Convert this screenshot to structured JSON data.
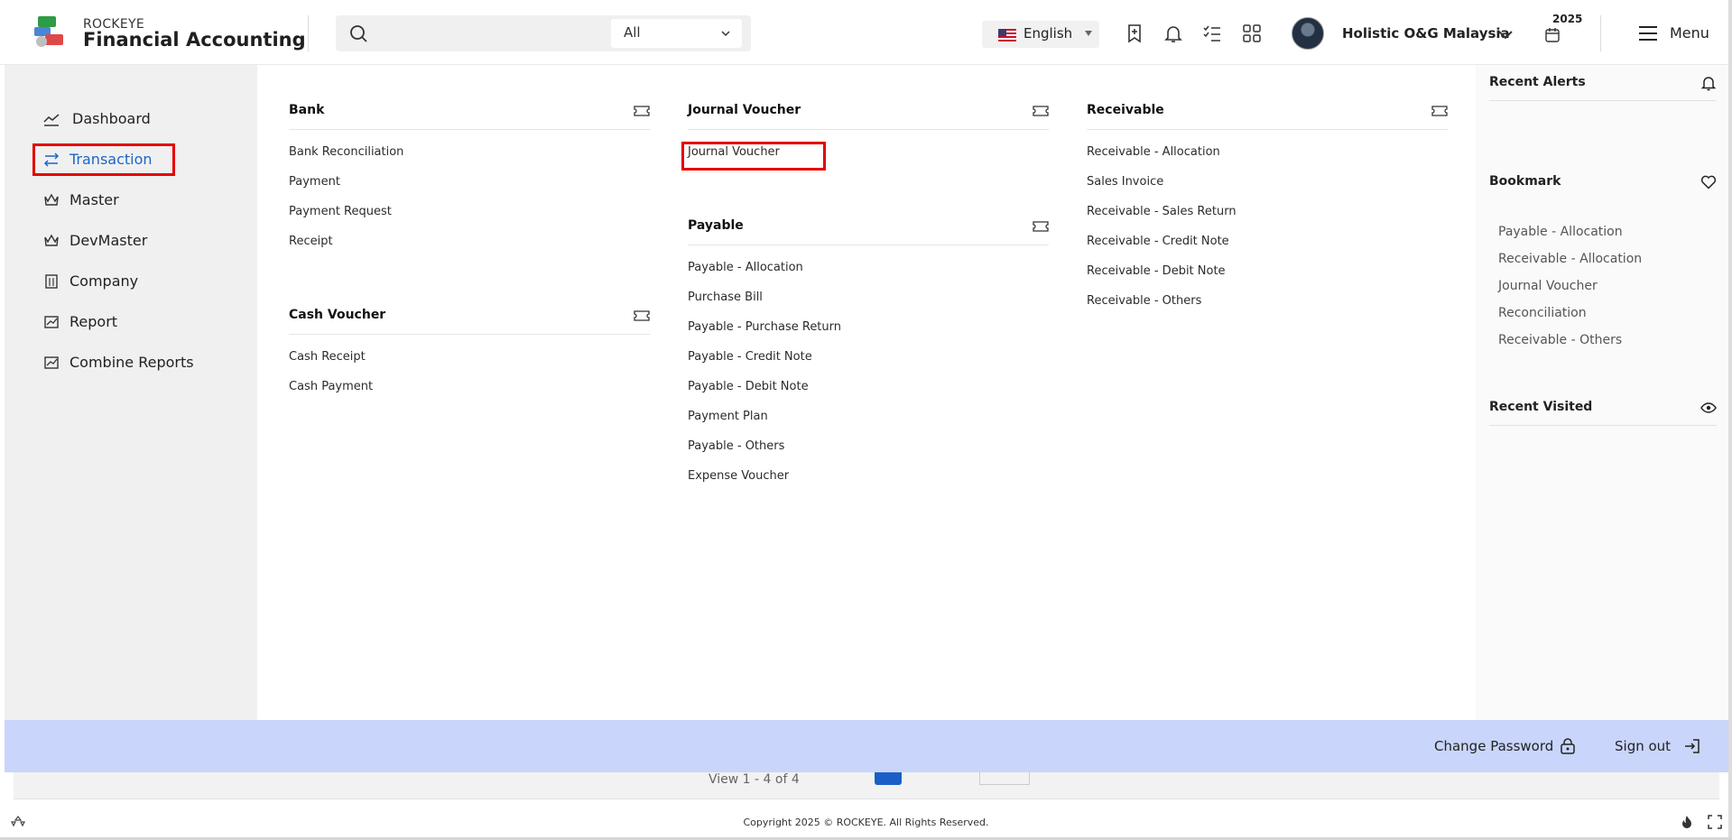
{
  "header": {
    "brand_top": "ROCKEYE",
    "brand_main": "Financial Accounting",
    "search": {
      "placeholder": "",
      "filter_value": "All"
    },
    "language": "English",
    "user_name": "Holistic O&G Malaysia",
    "year": "2025",
    "menu_label": "Menu"
  },
  "sidebar": {
    "items": [
      {
        "label": "Dashboard",
        "icon": "trend-icon",
        "active": false
      },
      {
        "label": "Transaction",
        "icon": "swap-icon",
        "active": true
      },
      {
        "label": "Master",
        "icon": "crown-icon",
        "active": false
      },
      {
        "label": "DevMaster",
        "icon": "crown-icon",
        "active": false
      },
      {
        "label": "Company",
        "icon": "building-icon",
        "active": false
      },
      {
        "label": "Report",
        "icon": "chart-icon",
        "active": false
      },
      {
        "label": "Combine Reports",
        "icon": "chart-icon",
        "active": false
      }
    ]
  },
  "sections": {
    "bank": {
      "title": "Bank",
      "links": [
        "Bank Reconciliation",
        "Payment",
        "Payment Request",
        "Receipt"
      ]
    },
    "cash_voucher": {
      "title": "Cash Voucher",
      "links": [
        "Cash Receipt",
        "Cash Payment"
      ]
    },
    "journal_voucher": {
      "title": "Journal Voucher",
      "links": [
        "Journal Voucher"
      ]
    },
    "payable": {
      "title": "Payable",
      "links": [
        "Payable - Allocation",
        "Purchase Bill",
        "Payable - Purchase Return",
        "Payable - Credit Note",
        "Payable - Debit Note",
        "Payment Plan",
        "Payable - Others",
        "Expense Voucher"
      ]
    },
    "receivable": {
      "title": "Receivable",
      "links": [
        "Receivable - Allocation",
        "Sales Invoice",
        "Receivable - Sales Return",
        "Receivable - Credit Note",
        "Receivable - Debit Note",
        "Receivable - Others"
      ]
    }
  },
  "right_panel": {
    "recent_alerts": "Recent Alerts",
    "bookmark": "Bookmark",
    "bookmarks": [
      "Payable - Allocation",
      "Receivable - Allocation",
      "Journal Voucher",
      "Reconciliation",
      "Receivable - Others"
    ],
    "recent_visited": "Recent Visited"
  },
  "footer": {
    "change_password": "Change Password",
    "sign_out": "Sign out",
    "pager_text": "View 1 - 4 of 4",
    "copyright": "Copyright 2025 © ROCKEYE. All Rights Reserved."
  },
  "colors": {
    "accent": "#1a66c7",
    "highlight": "#e60000",
    "footer_bar": "#c9d5fa"
  }
}
